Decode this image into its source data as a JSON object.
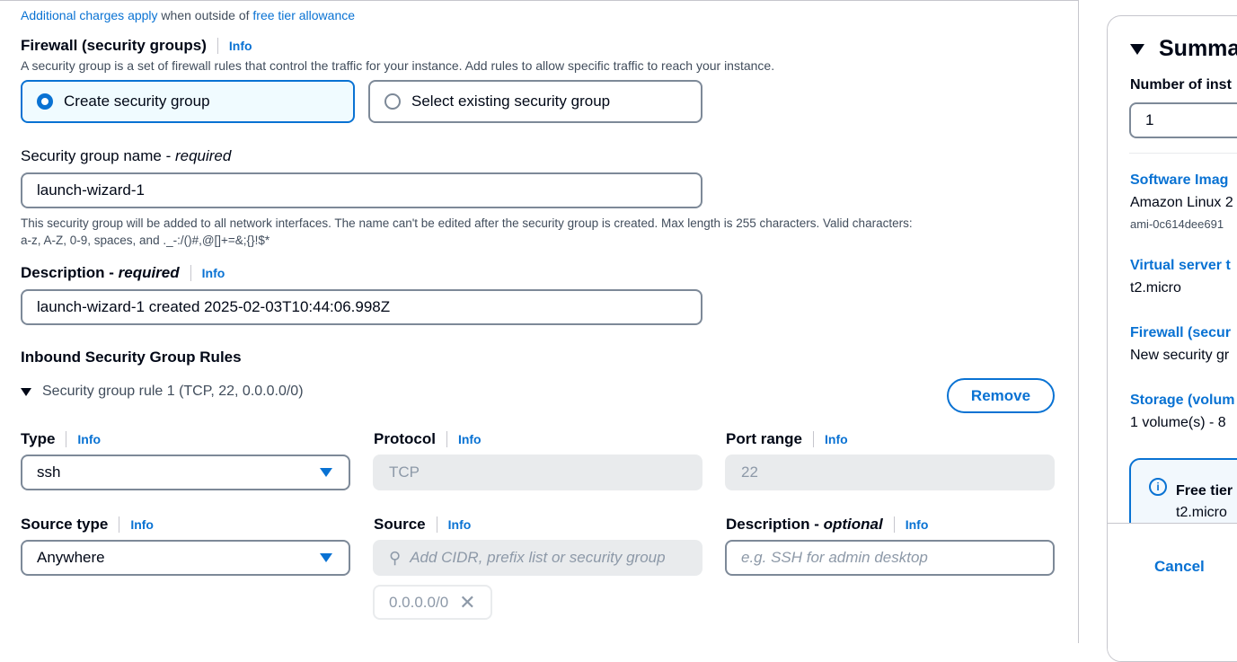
{
  "charges": {
    "link1": "Additional charges apply",
    "middle": " when outside of ",
    "link2": "free tier allowance"
  },
  "firewall": {
    "title": "Firewall (security groups)",
    "info": "Info",
    "description": "A security group is a set of firewall rules that control the traffic for your instance. Add rules to allow specific traffic to reach your instance.",
    "options": [
      {
        "label": "Create security group",
        "selected": true
      },
      {
        "label": "Select existing security group",
        "selected": false
      }
    ]
  },
  "sg_name": {
    "label": "Security group name - ",
    "req": "required",
    "value": "launch-wizard-1",
    "help1": "This security group will be added to all network interfaces. The name can't be edited after the security group is created. Max length is 255 characters. Valid characters:",
    "help2": "a-z, A-Z, 0-9, spaces, and ._-:/()#,@[]+=&;{}!$*"
  },
  "description": {
    "label": "Description - ",
    "req": "required",
    "info": "Info",
    "value": "launch-wizard-1 created 2025-02-03T10:44:06.998Z"
  },
  "inbound": {
    "title": "Inbound Security Group Rules",
    "rule_title": "Security group rule 1 (TCP, 22, 0.0.0.0/0)",
    "remove": "Remove",
    "type": {
      "label": "Type",
      "info": "Info",
      "value": "ssh"
    },
    "protocol": {
      "label": "Protocol",
      "info": "Info",
      "value": "TCP"
    },
    "port": {
      "label": "Port range",
      "info": "Info",
      "value": "22"
    },
    "source_type": {
      "label": "Source type",
      "info": "Info",
      "value": "Anywhere"
    },
    "source": {
      "label": "Source",
      "info": "Info",
      "placeholder": "Add CIDR, prefix list or security group",
      "token": "0.0.0.0/0"
    },
    "rule_desc": {
      "label": "Description - ",
      "opt": "optional",
      "info": "Info",
      "placeholder": "e.g. SSH for admin desktop"
    }
  },
  "summary": {
    "title": "Summa",
    "instances_label": "Number of inst",
    "instances_value": "1",
    "image_label": "Software Imag",
    "image_value": "Amazon Linux 2",
    "ami": "ami-0c614dee691",
    "server_label": "Virtual server t",
    "server_value": "t2.micro",
    "fw_label": "Firewall (secur",
    "fw_value": "New security gr",
    "storage_label": "Storage (volum",
    "storage_value": "1 volume(s) - 8",
    "free_title": "Free tier",
    "free_value": "t2.micro",
    "cancel": "Cancel"
  }
}
